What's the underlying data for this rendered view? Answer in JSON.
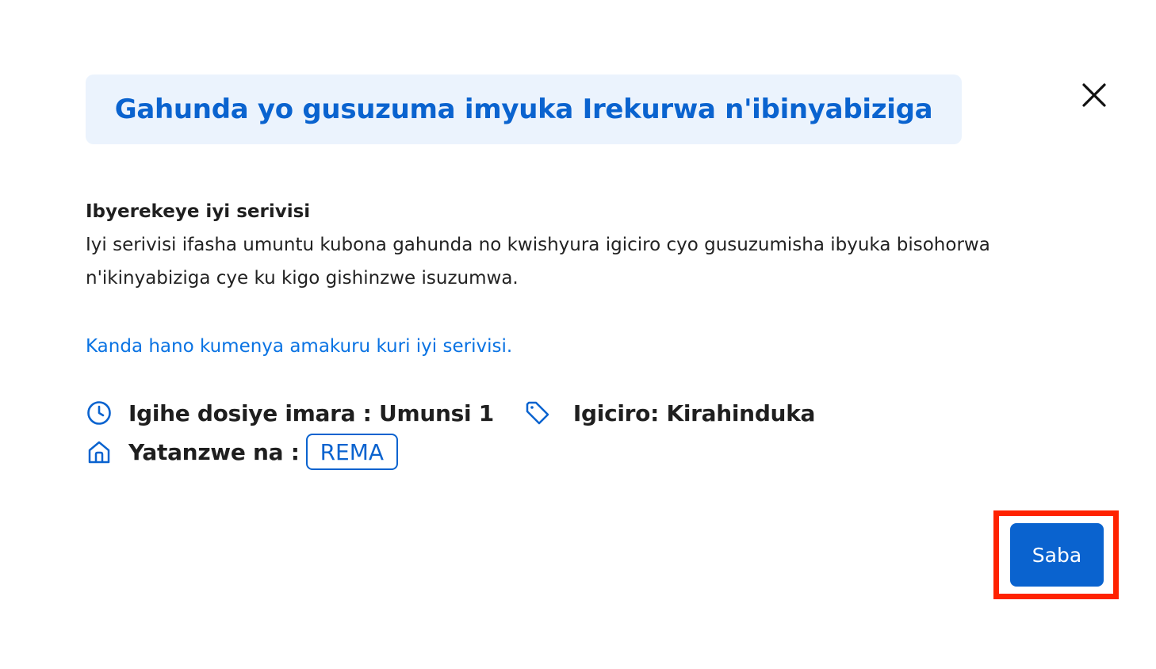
{
  "modal": {
    "title": "Gahunda yo gusuzuma imyuka Irekurwa n'ibinyabiziga",
    "close_icon": "close-icon"
  },
  "about": {
    "heading": "Ibyerekeye iyi serivisi",
    "description": "Iyi serivisi ifasha umuntu kubona gahunda no kwishyura igiciro cyo gusuzumisha ibyuka bisohorwa n'ikinyabiziga cye ku kigo gishinzwe isuzumwa.",
    "link_text": "Kanda hano kumenya amakuru kuri iyi serivisi."
  },
  "meta": {
    "duration_icon": "clock-icon",
    "duration": "Igihe dosiye imara : Umunsi 1",
    "price_icon": "tag-icon",
    "price": "Igiciro: Kirahinduka",
    "agency_icon": "building-icon",
    "agency_label": "Yatanzwe na :",
    "agency_name": "REMA"
  },
  "actions": {
    "apply_label": "Saba"
  },
  "colors": {
    "primary": "#0a63cf",
    "link": "#0a73e3",
    "title_bg": "#ebf3fd",
    "highlight": "#ff2200"
  }
}
